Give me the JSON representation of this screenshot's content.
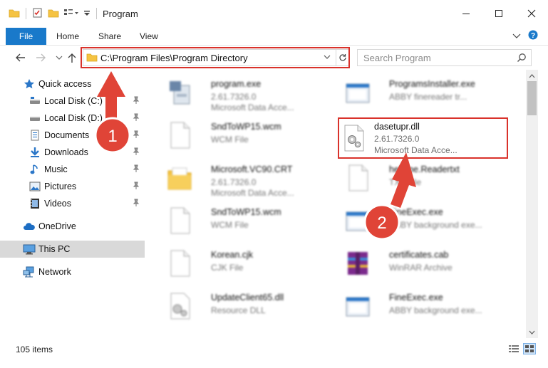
{
  "window": {
    "title": "Program",
    "controls": {
      "minimize": "minimize",
      "maximize": "maximize",
      "close": "close"
    }
  },
  "ribbon": {
    "tabs": [
      {
        "label": "File"
      },
      {
        "label": "Home"
      },
      {
        "label": "Share"
      },
      {
        "label": "View"
      }
    ]
  },
  "address_bar": {
    "path": "C:\\Program Files\\Program Directory"
  },
  "search": {
    "placeholder": "Search Program"
  },
  "nav_pane": {
    "quick_access": "Quick access",
    "items": [
      {
        "label": "Local Disk (C:)",
        "icon": "drive-icon",
        "pinned": true
      },
      {
        "label": "Local Disk (D:)",
        "icon": "drive-icon",
        "pinned": true
      },
      {
        "label": "Documents",
        "icon": "documents-icon",
        "pinned": true
      },
      {
        "label": "Downloads",
        "icon": "download-icon",
        "pinned": true
      },
      {
        "label": "Music",
        "icon": "music-icon",
        "pinned": true
      },
      {
        "label": "Pictures",
        "icon": "pictures-icon",
        "pinned": true
      },
      {
        "label": "Videos",
        "icon": "videos-icon",
        "pinned": true
      }
    ],
    "onedrive": "OneDrive",
    "this_pc": "This PC",
    "network": "Network"
  },
  "files": {
    "left": [
      {
        "name": "program.exe",
        "line1": "2.61.7326.0",
        "line2": "Microsoft Data Acce...",
        "icon": "exe-icon"
      },
      {
        "name": "SndToWP15.wcm",
        "line1": "WCM File",
        "line2": "",
        "icon": "file-icon"
      },
      {
        "name": "Microsoft.VC90.CRT",
        "line1": "2.61.7326.0",
        "line2": "Microsoft Data Acce...",
        "icon": "folder-icon"
      },
      {
        "name": "SndToWP15.wcm",
        "line1": "WCM File",
        "line2": "",
        "icon": "file-icon"
      },
      {
        "name": "Korean.cjk",
        "line1": "CJK File",
        "line2": "",
        "icon": "file-icon"
      },
      {
        "name": "UpdateClient65.dll",
        "line1": "Resource DLL",
        "line2": "",
        "icon": "dll-icon"
      }
    ],
    "right": [
      {
        "name": "ProgramsInstaller.exe",
        "line1": "ABBY finereader tr...",
        "line2": "",
        "icon": "app-icon"
      },
      {
        "name": "dasetupr.dll",
        "line1": "2.61.7326.0",
        "line2": "Microsoft Data Acce...",
        "icon": "dll-gear-icon",
        "highlighted": true
      },
      {
        "name": "helpme.Readertxt",
        "line1": "TXT File",
        "line2": "",
        "icon": "text-file-icon"
      },
      {
        "name": "FineExec.exe",
        "line1": "ABBY background exe...",
        "line2": "",
        "icon": "app-icon"
      },
      {
        "name": "certificates.cab",
        "line1": "WinRAR Archive",
        "line2": "",
        "icon": "archive-icon"
      },
      {
        "name": "FineExec.exe",
        "line1": "ABBY background exe...",
        "line2": "",
        "icon": "app-icon"
      }
    ]
  },
  "status": {
    "item_count": "105 items"
  },
  "annotations": {
    "marker1": "1",
    "marker2": "2"
  },
  "colors": {
    "accent": "#1979ca",
    "highlight_border": "#d9322b",
    "marker_fill": "#e04437"
  }
}
